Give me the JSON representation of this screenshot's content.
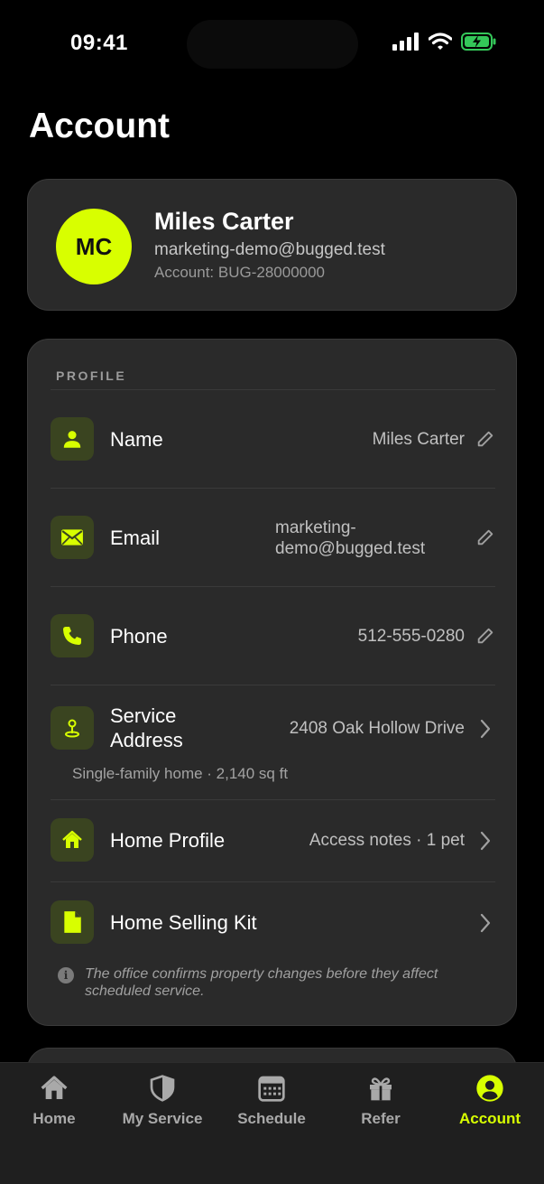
{
  "status_bar": {
    "time": "09:41"
  },
  "page": {
    "title": "Account"
  },
  "profile_card": {
    "initials": "MC",
    "name": "Miles Carter",
    "email": "marketing-demo@bugged.test",
    "account": "Account: BUG-28000000"
  },
  "profile_section": {
    "label": "PROFILE",
    "rows": [
      {
        "label": "Name",
        "value": "Miles Carter",
        "icon": "person-icon",
        "action": "edit"
      },
      {
        "label": "Email",
        "value_line1": "marketing-",
        "value_line2": "demo@bugged.test",
        "icon": "mail-icon",
        "action": "edit"
      },
      {
        "label": "Phone",
        "value": "512-555-0280",
        "icon": "phone-icon",
        "action": "edit"
      },
      {
        "label_line1": "Service",
        "label_line2": "Address",
        "value": "2408 Oak Hollow Drive",
        "sub": "Single-family home · 2,140 sq ft",
        "icon": "location-pin-icon",
        "action": "chevron"
      },
      {
        "label": "Home Profile",
        "value": "Access notes · 1 pet",
        "icon": "house-icon",
        "action": "chevron"
      },
      {
        "label": "Home Selling Kit",
        "icon": "document-icon",
        "action": "chevron"
      }
    ],
    "note": "The office confirms property changes before they affect scheduled service."
  },
  "tab_bar": {
    "tabs": [
      {
        "label": "Home",
        "icon": "home-icon"
      },
      {
        "label": "My Service",
        "icon": "shield-icon"
      },
      {
        "label": "Schedule",
        "icon": "calendar-icon"
      },
      {
        "label": "Refer",
        "icon": "gift-icon"
      },
      {
        "label": "Account",
        "icon": "account-icon",
        "active": true
      }
    ]
  },
  "colors": {
    "accent": "#d8ff00",
    "background": "#000000",
    "card": "#2a2a2a",
    "battery": "#34c759"
  }
}
